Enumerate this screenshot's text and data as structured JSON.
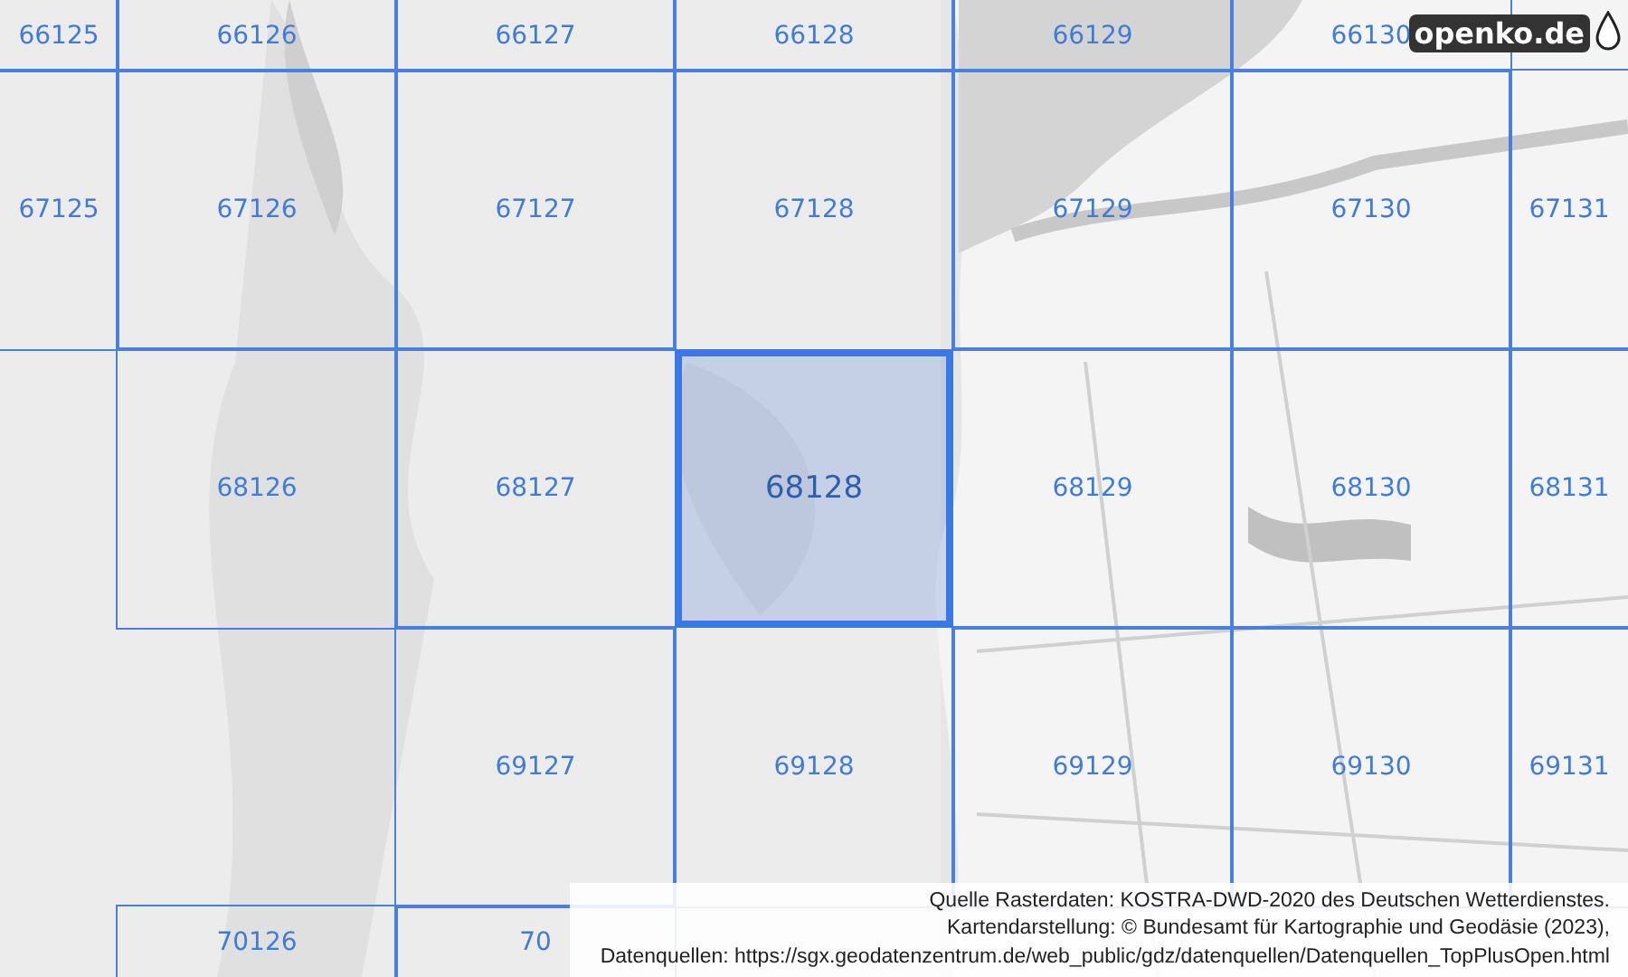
{
  "grid": {
    "rows": [
      [
        {
          "label": "66125",
          "selected": false
        },
        {
          "label": "66126",
          "selected": false
        },
        {
          "label": "66127",
          "selected": false
        },
        {
          "label": "66128",
          "selected": false
        },
        {
          "label": "66129",
          "selected": false
        },
        {
          "label": "66130",
          "selected": false
        }
      ],
      [
        {
          "label": "67125",
          "selected": false
        },
        {
          "label": "67126",
          "selected": false
        },
        {
          "label": "67127",
          "selected": false
        },
        {
          "label": "67128",
          "selected": false
        },
        {
          "label": "67129",
          "selected": false
        },
        {
          "label": "67130",
          "selected": false
        },
        {
          "label": "67131",
          "selected": false
        }
      ],
      [
        null,
        {
          "label": "68126",
          "selected": false
        },
        {
          "label": "68127",
          "selected": false
        },
        {
          "label": "68128",
          "selected": true
        },
        {
          "label": "68129",
          "selected": false
        },
        {
          "label": "68130",
          "selected": false
        },
        {
          "label": "68131",
          "selected": false
        }
      ],
      [
        null,
        null,
        {
          "label": "69127",
          "selected": false
        },
        {
          "label": "69128",
          "selected": false
        },
        {
          "label": "69129",
          "selected": false
        },
        {
          "label": "69130",
          "selected": false
        },
        {
          "label": "69131",
          "selected": false
        }
      ],
      [
        null,
        {
          "label": "70126",
          "selected": false
        },
        {
          "label": "70",
          "selected": false
        }
      ]
    ]
  },
  "logo": {
    "text": "openko.de"
  },
  "attribution": [
    "Quelle Rasterdaten: KOSTRA-DWD-2020 des Deutschen Wetterdienstes.",
    "Kartendarstellung: © Bundesamt für Kartographie und Geodäsie (2023),",
    "Datenquellen: https://sgx.geodatenzentrum.de/web_public/gdz/datenquellen/Datenquellen_TopPlusOpen.html"
  ]
}
